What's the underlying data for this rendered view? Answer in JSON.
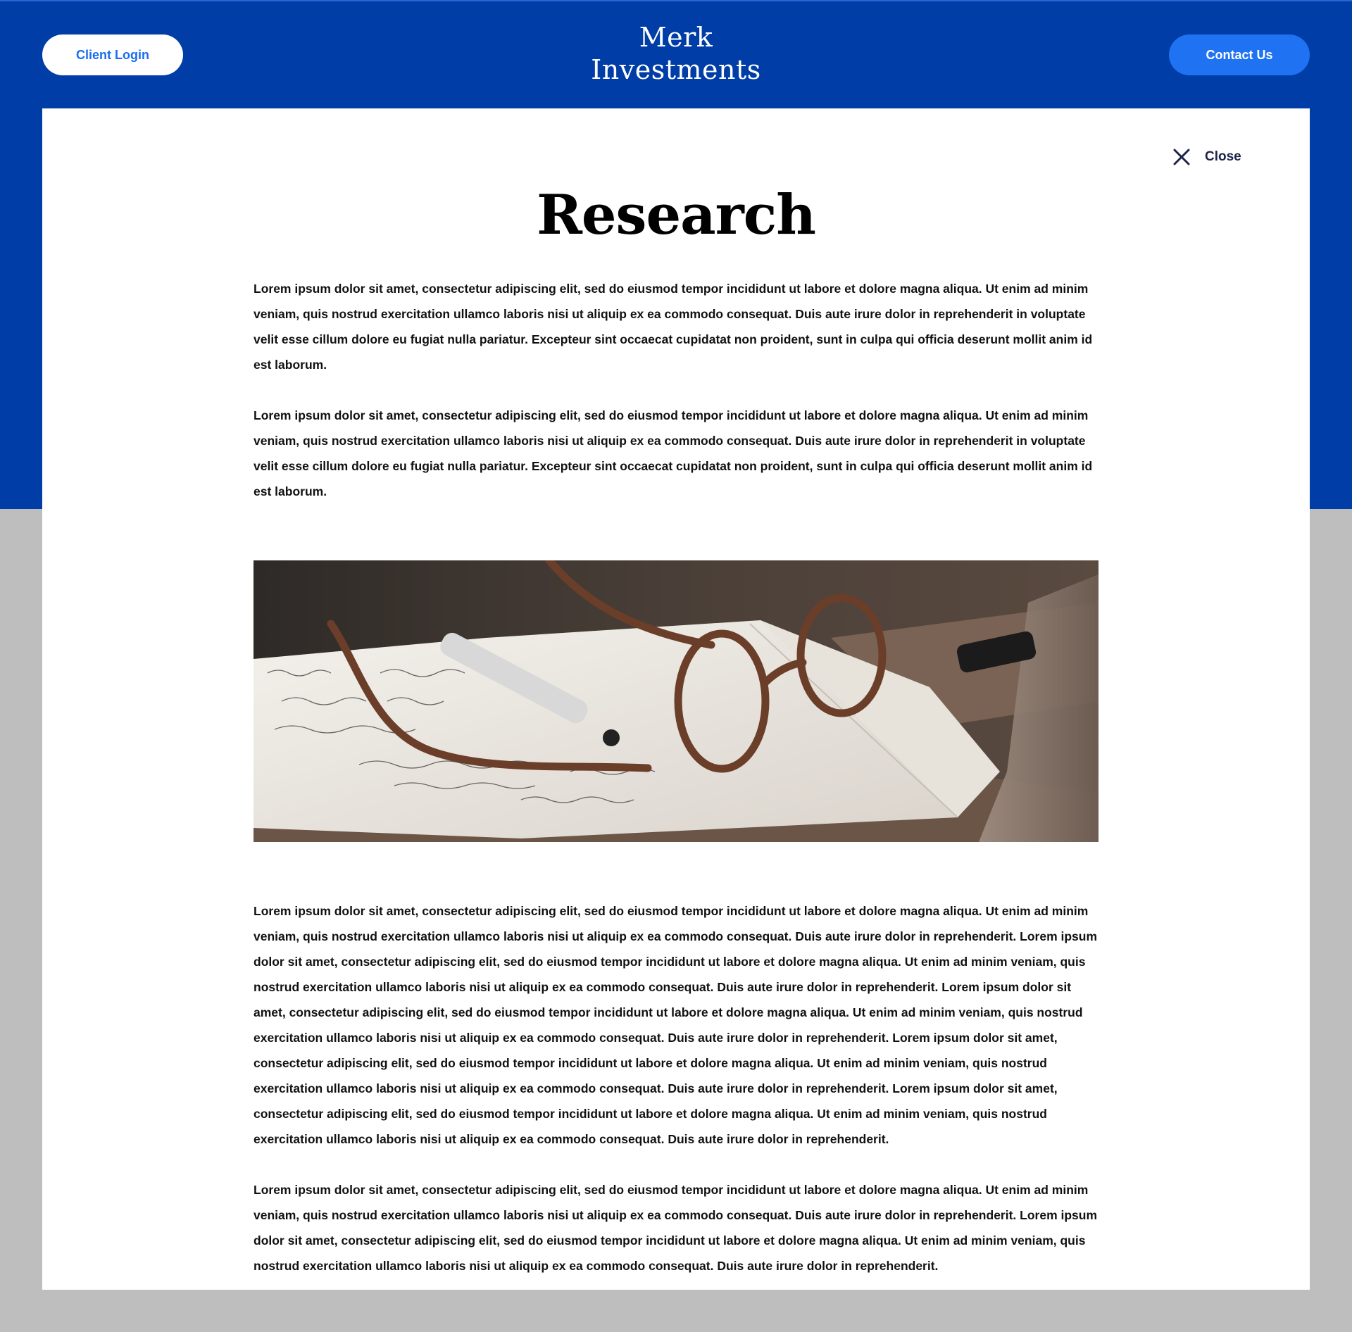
{
  "header": {
    "client_login_label": "Client Login",
    "logo_line1": "Merk",
    "logo_line2": "Investments",
    "contact_label": "Contact Us"
  },
  "colors": {
    "brand_blue": "#003da6",
    "accent_blue": "#1f72f2",
    "page_gray": "#bebebe",
    "panel_white": "#ffffff"
  },
  "modal": {
    "close_icon": "close-icon",
    "close_label": "Close",
    "title": "Research",
    "paragraphs": [
      "Lorem ipsum dolor sit amet, consectetur adipiscing elit, sed do eiusmod tempor incididunt ut labore et dolore magna aliqua. Ut enim ad minim veniam, quis nostrud exercitation ullamco laboris nisi ut aliquip ex ea commodo consequat. Duis aute irure dolor in reprehenderit in voluptate velit esse cillum dolore eu fugiat nulla pariatur. Excepteur sint occaecat cupidatat non proident, sunt in culpa qui officia deserunt mollit anim id est laborum.",
      "Lorem ipsum dolor sit amet, consectetur adipiscing elit, sed do eiusmod tempor incididunt ut labore et dolore magna aliqua. Ut enim ad minim veniam, quis nostrud exercitation ullamco laboris nisi ut aliquip ex ea commodo consequat. Duis aute irure dolor in reprehenderit in voluptate velit esse cillum dolore eu fugiat nulla pariatur. Excepteur sint occaecat cupidatat non proident, sunt in culpa qui officia deserunt mollit anim id est laborum.",
      "Lorem ipsum dolor sit amet, consectetur adipiscing elit, sed do eiusmod tempor incididunt ut labore et dolore magna aliqua. Ut enim ad minim veniam, quis nostrud exercitation ullamco laboris nisi ut aliquip ex ea commodo consequat. Duis aute irure dolor in reprehenderit. Lorem ipsum dolor sit amet, consectetur adipiscing elit, sed do eiusmod tempor incididunt ut labore et dolore magna aliqua. Ut enim ad minim veniam, quis nostrud exercitation ullamco laboris nisi ut aliquip ex ea commodo consequat. Duis aute irure dolor in reprehenderit. Lorem ipsum dolor sit amet, consectetur adipiscing elit, sed do eiusmod tempor incididunt ut labore et dolore magna aliqua. Ut enim ad minim veniam, quis nostrud exercitation ullamco laboris nisi ut aliquip ex ea commodo consequat. Duis aute irure dolor in reprehenderit. Lorem ipsum dolor sit amet, consectetur adipiscing elit, sed do eiusmod tempor incididunt ut labore et dolore magna aliqua. Ut enim ad minim veniam, quis nostrud exercitation ullamco laboris nisi ut aliquip ex ea commodo consequat. Duis aute irure dolor in reprehenderit. Lorem ipsum dolor sit amet, consectetur adipiscing elit, sed do eiusmod tempor incididunt ut labore et dolore magna aliqua. Ut enim ad minim veniam, quis nostrud exercitation ullamco laboris nisi ut aliquip ex ea commodo consequat. Duis aute irure dolor in reprehenderit.",
      "Lorem ipsum dolor sit amet, consectetur adipiscing elit, sed do eiusmod tempor incididunt ut labore et dolore magna aliqua. Ut enim ad minim veniam, quis nostrud exercitation ullamco laboris nisi ut aliquip ex ea commodo consequat. Duis aute irure dolor in reprehenderit. Lorem ipsum dolor sit amet, consectetur adipiscing elit, sed do eiusmod tempor incididunt ut labore et dolore magna aliqua. Ut enim ad minim veniam, quis nostrud exercitation ullamco laboris nisi ut aliquip ex ea commodo consequat. Duis aute irure dolor in reprehenderit."
    ]
  }
}
